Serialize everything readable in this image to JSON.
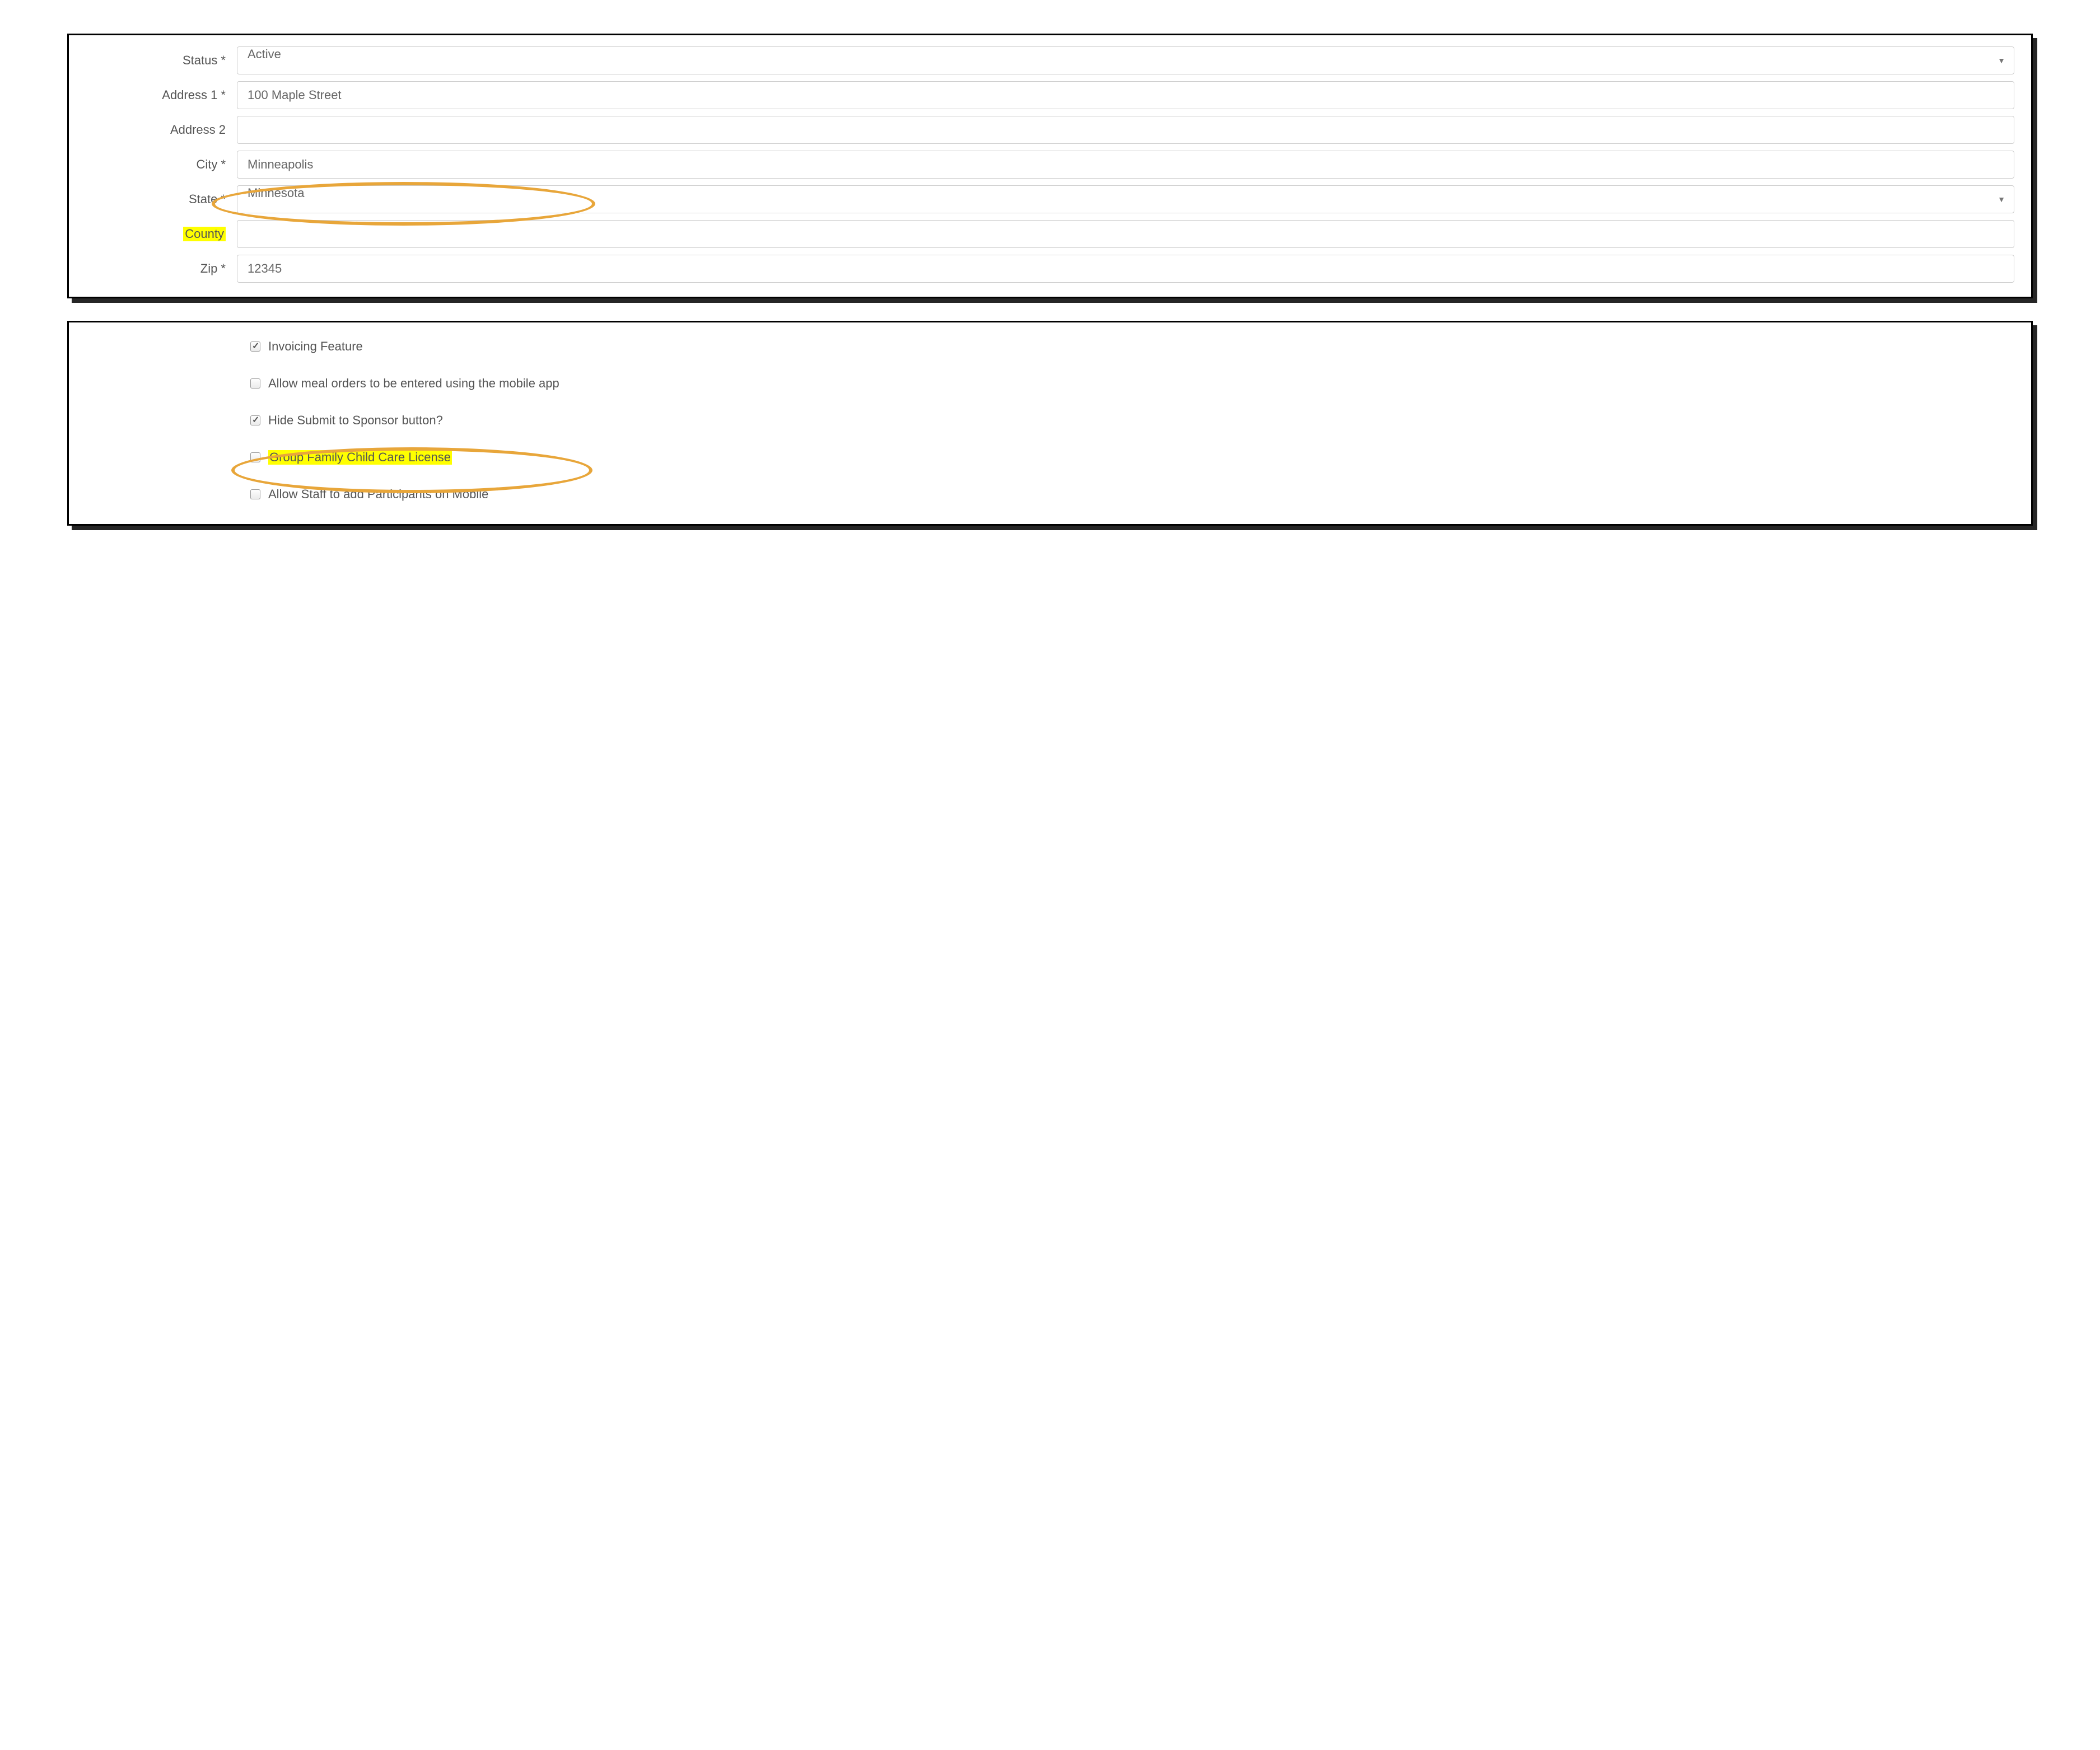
{
  "address_form": {
    "status": {
      "label": "Status *",
      "value": "Active"
    },
    "address1": {
      "label": "Address 1 *",
      "value": "100 Maple Street"
    },
    "address2": {
      "label": "Address 2",
      "value": ""
    },
    "city": {
      "label": "City *",
      "value": "Minneapolis"
    },
    "state": {
      "label": "State *",
      "value": "Minnesota"
    },
    "county": {
      "label": "County",
      "value": ""
    },
    "zip": {
      "label": "Zip *",
      "value": "12345"
    }
  },
  "options": {
    "invoicing": {
      "label": "Invoicing Feature",
      "checked": true
    },
    "meal_orders": {
      "label": "Allow meal orders to be entered using the mobile app",
      "checked": false
    },
    "hide_submit": {
      "label": "Hide Submit to Sponsor button?",
      "checked": true
    },
    "group_license": {
      "label": "Group Family Child Care License",
      "checked": false
    },
    "allow_staff": {
      "label": "Allow Staff to add Participants on Mobile",
      "checked": false
    }
  }
}
